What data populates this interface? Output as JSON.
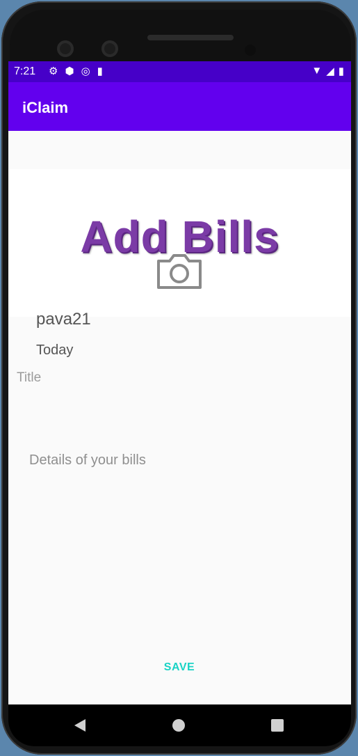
{
  "status_bar": {
    "time": "7:21",
    "left_icons": [
      "gear-icon",
      "shield-icon",
      "vpn-icon",
      "sd-card-icon"
    ],
    "right_icons": [
      "wifi-icon",
      "signal-icon",
      "battery-icon"
    ]
  },
  "app_bar": {
    "title": "iClaim"
  },
  "banner": {
    "title": "Add Bills",
    "icon": "camera-icon"
  },
  "form": {
    "username": "pava21",
    "date": "Today",
    "title_placeholder": "Title",
    "details_placeholder": "Details of your bills",
    "save_label": "SAVE"
  },
  "nav_bar": {
    "icons": [
      "back-icon",
      "home-icon",
      "recents-icon"
    ]
  },
  "colors": {
    "status_bar": "#4600c8",
    "app_bar": "#6200ee",
    "banner_text": "#7b3ba6",
    "save_button": "#19d3c5"
  }
}
